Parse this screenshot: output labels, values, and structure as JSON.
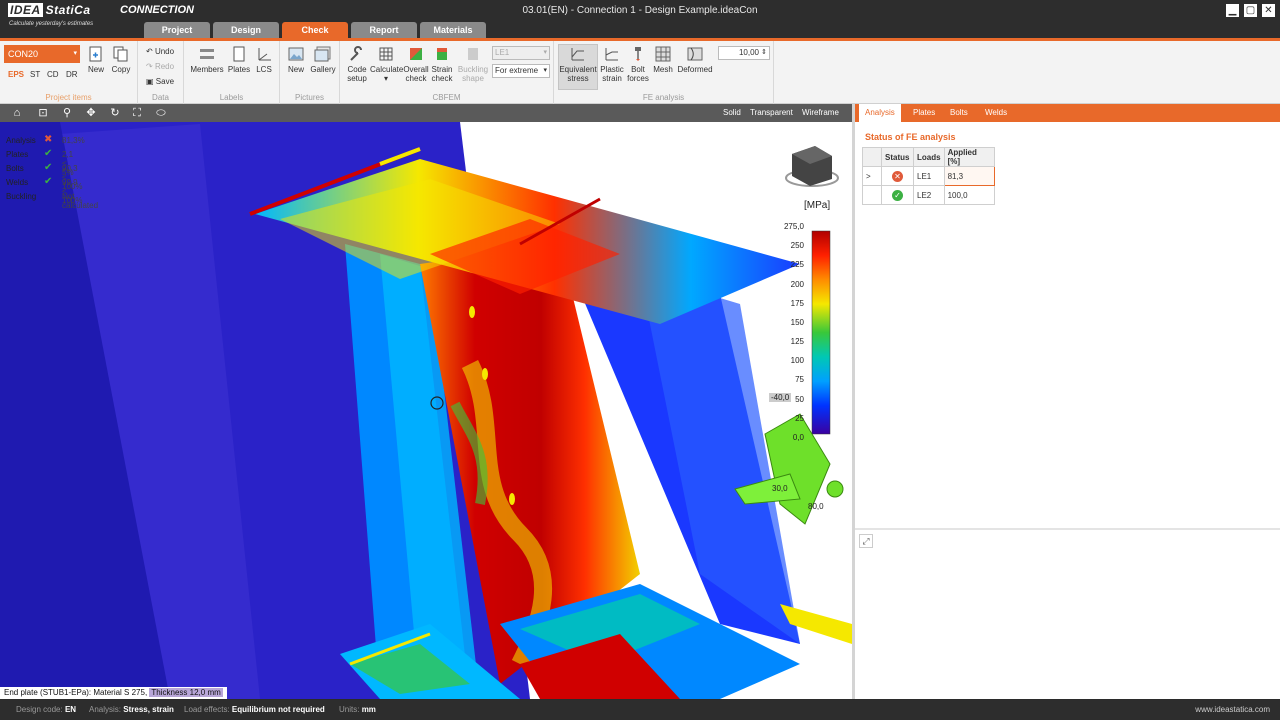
{
  "app": {
    "brand": "IDEA",
    "brand2": "StatiCa",
    "tagline": "Calculate yesterday's estimates",
    "product": "CONNECTION",
    "document_title": "03.01(EN) - Connection 1 - Design Example.ideaCon"
  },
  "window_controls": {
    "minimize": "▁",
    "maximize": "▢",
    "close": "✕"
  },
  "main_tabs": [
    {
      "label": "Project"
    },
    {
      "label": "Design"
    },
    {
      "label": "Check",
      "active": true
    },
    {
      "label": "Report"
    },
    {
      "label": "Materials"
    }
  ],
  "ribbon": {
    "project_items": {
      "label": "Project items",
      "connection_select": "CON20",
      "mini_tabs": [
        "EPS",
        "ST",
        "CD",
        "DR"
      ],
      "new": "New",
      "copy": "Copy"
    },
    "data": {
      "label": "Data",
      "undo": "Undo",
      "redo": "Redo",
      "save": "Save"
    },
    "labels": {
      "label": "Labels",
      "members": "Members",
      "plates": "Plates",
      "lcs": "LCS"
    },
    "pictures": {
      "label": "Pictures",
      "new": "New",
      "gallery": "Gallery"
    },
    "cbfem": {
      "label": "CBFEM",
      "code_setup": [
        "Code",
        "setup"
      ],
      "calculate": [
        "Calculate",
        "▾"
      ],
      "overall_check": [
        "Overall",
        "check"
      ],
      "strain_check": [
        "Strain",
        "check"
      ],
      "buckling_shape": [
        "Buckling",
        "shape"
      ],
      "load_effect": "LE1",
      "extreme": "For extreme"
    },
    "fe_analysis": {
      "label": "FE analysis",
      "equivalent_stress": [
        "Equivalent",
        "stress"
      ],
      "plastic_strain": [
        "Plastic",
        "strain"
      ],
      "bolt_forces": [
        "Bolt",
        "forces"
      ],
      "mesh": "Mesh",
      "deformed": "Deformed",
      "scale_value": "10,00"
    }
  },
  "viewport": {
    "modes": [
      "Solid",
      "Transparent",
      "Wireframe"
    ],
    "legend": [
      {
        "label": "Analysis",
        "status": "fail",
        "value": "81,3%"
      },
      {
        "label": "Plates",
        "status": "ok",
        "value": "2,1 < 5%"
      },
      {
        "label": "Bolts",
        "status": "ok",
        "value": "90,3 < 100%"
      },
      {
        "label": "Welds",
        "status": "ok",
        "value": "99,9 < 100%"
      },
      {
        "label": "Buckling",
        "status": "none",
        "value": "Not calculated"
      }
    ],
    "scale": {
      "unit": "[MPa]",
      "ticks": [
        "275,0",
        "250",
        "225",
        "200",
        "175",
        "150",
        "125",
        "100",
        "75",
        "50",
        "25",
        "0,0"
      ],
      "min_marker": "-40,0"
    },
    "gizmo_labels": [
      "30,0",
      "80,0"
    ],
    "status_text": "End plate (STUB1-EPa): Material S 275,",
    "status_highlight": "Thickness 12,0 mm"
  },
  "right_panel": {
    "tabs": [
      "Analysis",
      "Plates",
      "Bolts",
      "Welds"
    ],
    "active_tab": "Analysis",
    "heading": "Status of FE analysis",
    "table": {
      "headers": [
        "",
        "Status",
        "Loads",
        "Applied [%]"
      ],
      "rows": [
        {
          "expander": ">",
          "status": "fail",
          "loads": "LE1",
          "applied": "81,3"
        },
        {
          "expander": "",
          "status": "ok",
          "loads": "LE2",
          "applied": "100,0"
        }
      ]
    }
  },
  "bottom_bar": {
    "design_code_key": "Design code:",
    "design_code": "EN",
    "analysis_key": "Analysis:",
    "analysis": "Stress, strain",
    "load_effects_key": "Load effects:",
    "load_effects": "Equilibrium not required",
    "units_key": "Units:",
    "units": "mm",
    "website": "www.ideastatica.com"
  },
  "colors": {
    "accent": "#e8692a",
    "dark": "#2d2d2d",
    "fail": "#e05a3a",
    "ok": "#3cb043"
  }
}
